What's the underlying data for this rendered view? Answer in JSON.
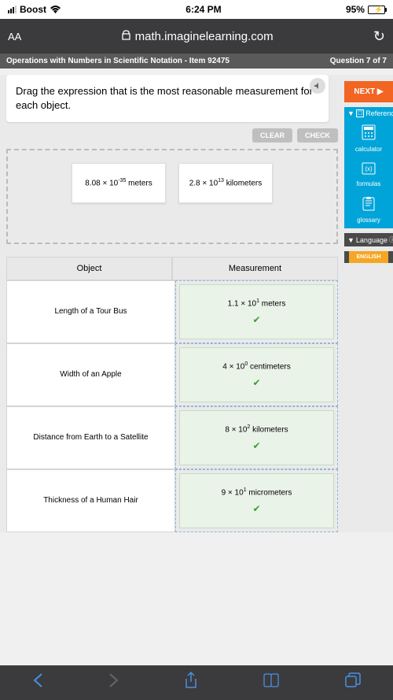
{
  "status": {
    "carrier": "Boost",
    "time": "6:24 PM",
    "battery": "95%"
  },
  "browser": {
    "text_size": "AA",
    "url": "math.imaginelearning.com"
  },
  "header": {
    "title": "Operations with Numbers in Scientific Notation - Item 92475",
    "progress": "Question 7 of 7"
  },
  "question": {
    "prompt": "Drag the expression that is the most reasonable measurement for each object."
  },
  "buttons": {
    "next": "NEXT ▶",
    "clear": "CLEAR",
    "check": "CHECK"
  },
  "sidebar": {
    "reference_label": "Reference",
    "items": [
      {
        "icon": "calc",
        "label": "calculator"
      },
      {
        "icon": "formula",
        "label": "formulas"
      },
      {
        "icon": "glossary",
        "label": "glossary"
      }
    ],
    "language_label": "Language",
    "english": "ENGLISH"
  },
  "drag_pool": [
    {
      "html": "8.08 × 10<sup>-35</sup> meters"
    },
    {
      "html": "2.8 × 10<sup>13</sup> kilometers"
    }
  ],
  "table": {
    "headers": {
      "object": "Object",
      "measurement": "Measurement"
    },
    "rows": [
      {
        "object": "Length of a Tour Bus",
        "measurement": "1.1 × 10<sup>1</sup> meters"
      },
      {
        "object": "Width of an Apple",
        "measurement": "4 × 10<sup>0</sup> centimeters"
      },
      {
        "object": "Distance from Earth to a Satellite",
        "measurement": "8 × 10<sup>2</sup> kilometers"
      },
      {
        "object": "Thickness of a Human Hair",
        "measurement": "9 × 10<sup>1</sup> micrometers"
      }
    ]
  }
}
